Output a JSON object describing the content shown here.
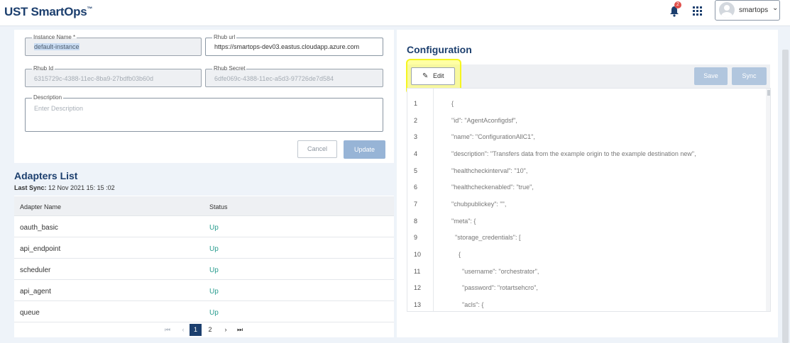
{
  "header": {
    "logo": "UST SmartOps",
    "logo_tm": "™",
    "notification_count": "2",
    "user_name": "smartops"
  },
  "instance": {
    "name_label": "Instance Name *",
    "name_value": "default-instance",
    "rhub_url_label": "Rhub url",
    "rhub_url_value": "https://smartops-dev03.eastus.cloudapp.azure.com",
    "rhub_id_label": "Rhub Id",
    "rhub_id_value": "6315729c-4388-11ec-8ba9-27bdfb03b60d",
    "rhub_secret_label": "Rhub Secret",
    "rhub_secret_value": "6dfe069c-4388-11ec-a5d3-97726de7d584",
    "description_label": "Description",
    "description_placeholder": "Enter Description",
    "cancel_label": "Cancel",
    "update_label": "Update"
  },
  "adapters": {
    "title": "Adapters List",
    "last_sync_label": "Last Sync:",
    "last_sync_value": "12 Nov 2021 15: 15 :02",
    "col_name": "Adapter Name",
    "col_status": "Status",
    "rows": [
      {
        "name": "oauth_basic",
        "status": "Up"
      },
      {
        "name": "api_endpoint",
        "status": "Up"
      },
      {
        "name": "scheduler",
        "status": "Up"
      },
      {
        "name": "api_agent",
        "status": "Up"
      },
      {
        "name": "queue",
        "status": "Up"
      }
    ],
    "pager": {
      "first": "⏮",
      "prev": "‹",
      "page1": "1",
      "page2": "2",
      "next": "›",
      "last": "⏭"
    }
  },
  "config": {
    "title": "Configuration",
    "edit_label": "Edit",
    "save_label": "Save",
    "sync_label": "Sync",
    "lines": [
      {
        "n": "1",
        "text": "{"
      },
      {
        "n": "2",
        "text": "\"id\": \"AgentAconfigdsf\","
      },
      {
        "n": "3",
        "text": "\"name\": \"ConfigurationAllC1\","
      },
      {
        "n": "4",
        "text": "\"description\": \"Transfers data from the example origin to the example destination new\","
      },
      {
        "n": "5",
        "text": "\"healthcheckinterval\": \"10\","
      },
      {
        "n": "6",
        "text": "\"healthcheckenabled\": \"true\","
      },
      {
        "n": "7",
        "text": "\"chubpublickey\": \"\","
      },
      {
        "n": "8",
        "text": "\"meta\": {"
      },
      {
        "n": "9",
        "text": "  \"storage_credentials\": ["
      },
      {
        "n": "10",
        "text": "    {"
      },
      {
        "n": "11",
        "text": "      \"username\": \"orchestrator\","
      },
      {
        "n": "12",
        "text": "      \"password\": \"rotartsehcro\","
      },
      {
        "n": "13",
        "text": "      \"acls\": {"
      }
    ]
  }
}
